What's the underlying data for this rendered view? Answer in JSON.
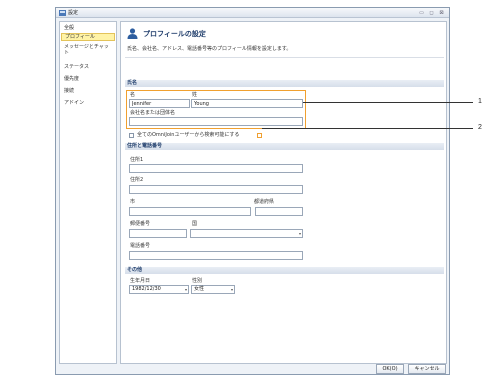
{
  "window": {
    "title": "設定"
  },
  "sidebar": {
    "items": [
      {
        "label": "全般"
      },
      {
        "label": "プロフィール"
      },
      {
        "label": "メッセージとチャット"
      },
      {
        "label": "ステータス"
      },
      {
        "label": "優先度"
      },
      {
        "label": "接続"
      },
      {
        "label": "アドイン"
      }
    ]
  },
  "main": {
    "title": "プロフィールの設定",
    "description": "氏名、会社名、アドレス、電話番号等のプロフィール情報を設定します。",
    "name_section": {
      "header": "氏名",
      "first_label": "名",
      "last_label": "姓",
      "first_value": "Jennifer",
      "last_value": "Young",
      "company_label": "会社名または団体名",
      "company_value": "",
      "searchable_label": "全てのOmniJoinユーザーから検索可能にする"
    },
    "address_section": {
      "header": "住所と電話番号",
      "address1_label": "住所1",
      "address2_label": "住所2",
      "city_label": "市",
      "state_label": "都道府県",
      "zip_label": "郵便番号",
      "country_label": "国",
      "phone_label": "電話番号"
    },
    "other_section": {
      "header": "その他",
      "birthday_label": "生年月日",
      "birthday_value": "1982/12/30",
      "gender_label": "性別",
      "gender_value": "女性"
    }
  },
  "footer": {
    "ok_label": "OK(O)",
    "cancel_label": "キャンセル"
  },
  "callouts": [
    "1",
    "2"
  ],
  "colors": {
    "highlight": "#f0a030",
    "active_item": "#fff3a6",
    "title": "#1f3d6b"
  }
}
